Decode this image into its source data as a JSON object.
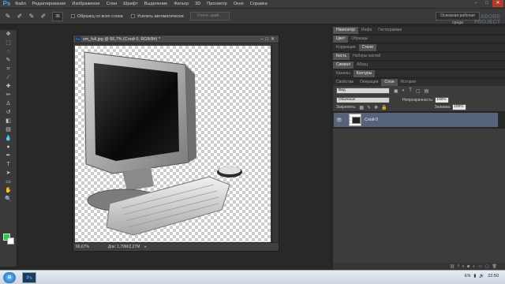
{
  "menubar": {
    "logo": "Ps",
    "items": [
      "Файл",
      "Редактирование",
      "Изображение",
      "Слои",
      "Шрифт",
      "Выделение",
      "Фильтр",
      "3D",
      "Просмотр",
      "Окно",
      "Справка"
    ]
  },
  "options": {
    "brush_size": "35",
    "sample_all_label": "Образец со всех слоев",
    "auto_enhance_label": "Усилить автоматически",
    "refine_edge_label": "Уточн. край...",
    "workspace_label": "Основная рабочая среда"
  },
  "document": {
    "title": "sm_full.jpg @ 66,7% (Слой 0, RGB/8#) *",
    "zoom": "66,67%",
    "doc_info": "Док: 1,79M/2,27M"
  },
  "panels": {
    "navigator_tabs": [
      "Навигатор",
      "Инфо",
      "Гистограмма"
    ],
    "swatches_tabs": [
      "Цвет",
      "Образцы"
    ],
    "adjustments_tabs": [
      "Коррекция",
      "Стили"
    ],
    "brush_tabs": [
      "Кисть",
      "Наборы кистей"
    ],
    "char_tabs": [
      "Символ",
      "Абзац"
    ],
    "channels_tabs": [
      "Каналы",
      "Контуры"
    ],
    "layers_tabs": [
      "Свойства",
      "Операции",
      "Слои",
      "История"
    ]
  },
  "layers": {
    "kind_select": "Вид",
    "blend_mode": "Обычные",
    "opacity_label": "Непрозрачность:",
    "opacity_value": "100%",
    "lock_label": "Закрепить:",
    "fill_label": "Заливка:",
    "fill_value": "100%",
    "layer_name": "Слой 0"
  },
  "watermark": {
    "line1": "ADOBE",
    "line2": "PROJECT"
  },
  "taskbar": {
    "app": "Ps",
    "lang": "EN",
    "time": "22:50"
  }
}
